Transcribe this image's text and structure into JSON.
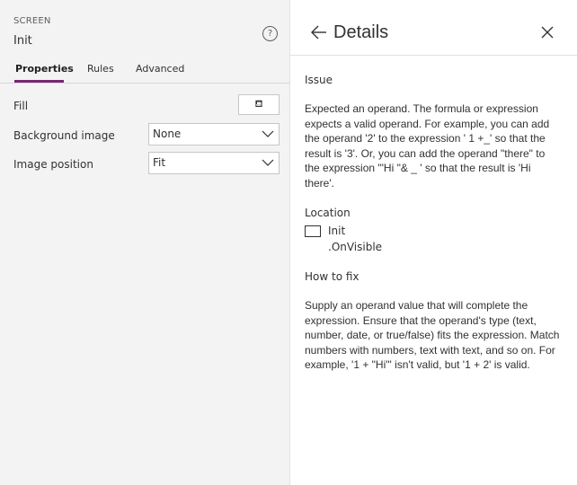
{
  "left": {
    "section_label": "SCREEN",
    "screen_name": "Init",
    "help_glyph": "?",
    "tabs": [
      {
        "label": "Properties",
        "active": true
      },
      {
        "label": "Rules",
        "active": false
      },
      {
        "label": "Advanced",
        "active": false
      }
    ],
    "properties": {
      "fill_label": "Fill",
      "fill_icon_glyph": "⛾",
      "background_image_label": "Background image",
      "background_image_value": "None",
      "image_position_label": "Image position",
      "image_position_value": "Fit"
    },
    "accent_color": "#742774"
  },
  "details": {
    "title": "Details",
    "issue_heading": "Issue",
    "issue_text": "Expected an operand. The formula or expression expects a valid operand. For example, you can add the operand '2' to the expression ' 1 +_' so that the result is '3'. Or, you can add the operand \"there\" to the expression '\"Hi \"& _ ' so that the result is 'Hi there'.",
    "location_heading": "Location",
    "location_name": "Init",
    "location_property": ".OnVisible",
    "fix_heading": "How to fix",
    "fix_text": "Supply an operand value that will complete the expression. Ensure that the operand's type (text, number, date, or true/false) fits the expression. Match numbers with numbers, text with text, and so on. For example, '1 + \"Hi\"' isn't valid, but '1 + 2' is valid."
  }
}
